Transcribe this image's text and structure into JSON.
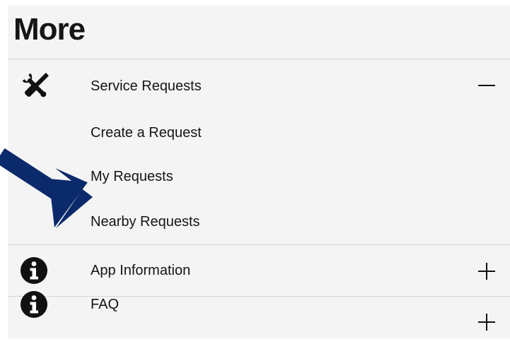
{
  "header": {
    "title": "More"
  },
  "sections": [
    {
      "icon": "tools-icon",
      "label": "Service Requests",
      "toggle": "collapse",
      "expanded": true,
      "items": [
        {
          "label": "Create a Request"
        },
        {
          "label": "My Requests"
        },
        {
          "label": "Nearby Requests"
        }
      ]
    },
    {
      "icon": "info-icon",
      "label": "App Information",
      "toggle": "expand",
      "expanded": false
    },
    {
      "icon": "info-icon",
      "label": "FAQ",
      "toggle": "expand",
      "expanded": false
    }
  ],
  "annotation": {
    "icon": "pointer-arrow-icon",
    "color": "#0b2a6b",
    "points_to": "Nearby Requests"
  },
  "colors": {
    "panel_background": "#f4f4f4",
    "divider": "#d3d3d3",
    "text": "#151515"
  }
}
